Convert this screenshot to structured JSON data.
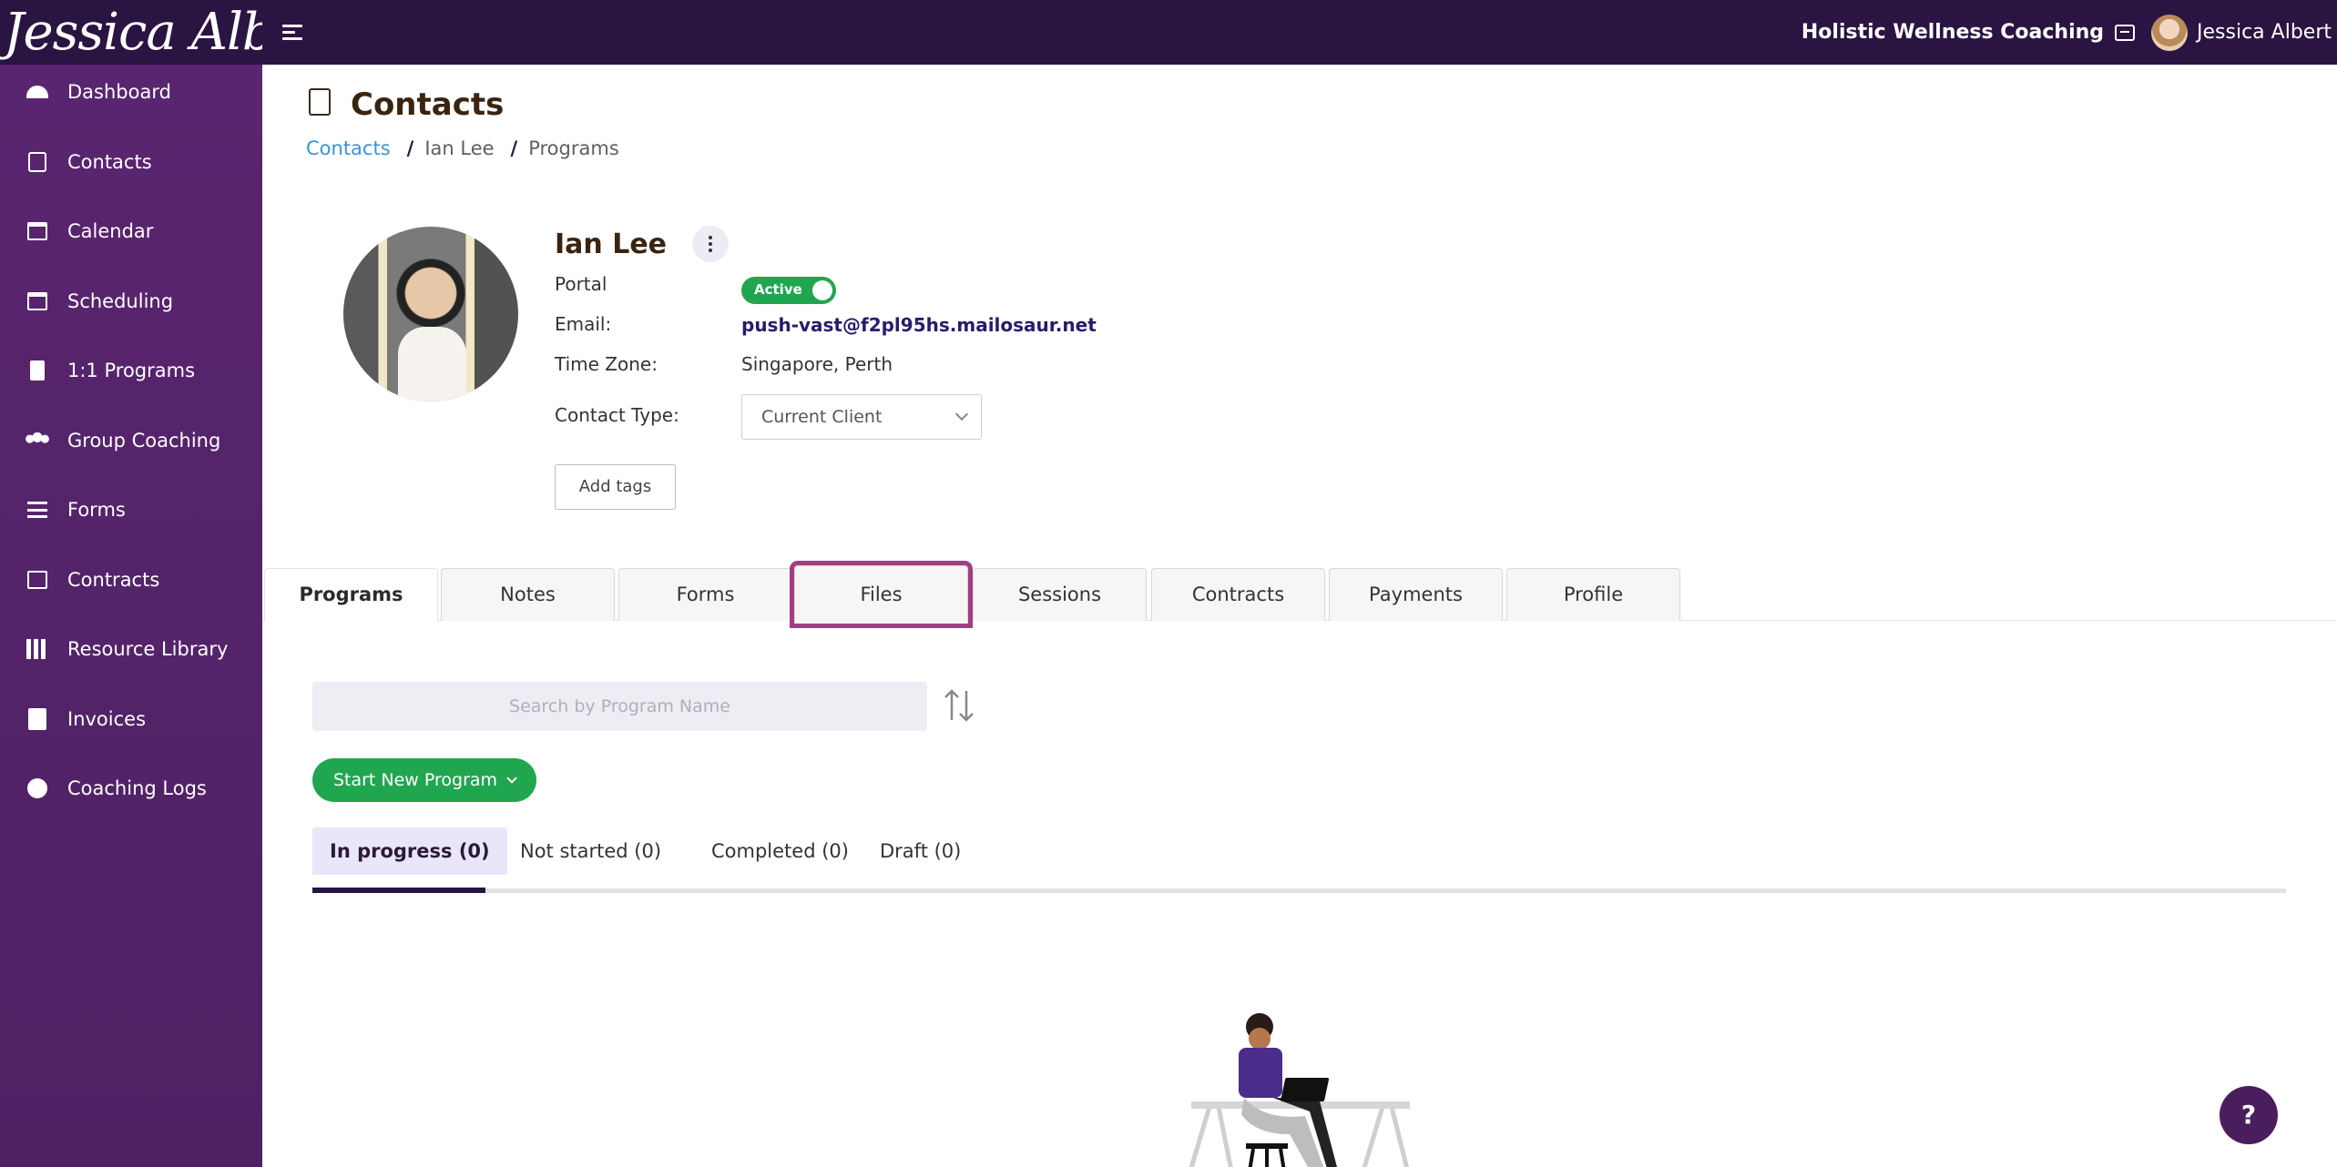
{
  "app": {
    "logo_text": "Jessica Albert",
    "business_name": "Holistic Wellness Coaching",
    "user_name": "Jessica Albert"
  },
  "sidebar": {
    "items": [
      {
        "label": "Dashboard",
        "icon": "dashboard-icon"
      },
      {
        "label": "Contacts",
        "icon": "contacts-icon"
      },
      {
        "label": "Calendar",
        "icon": "calendar-icon"
      },
      {
        "label": "Scheduling",
        "icon": "scheduling-icon"
      },
      {
        "label": "1:1 Programs",
        "icon": "book-icon"
      },
      {
        "label": "Group Coaching",
        "icon": "group-icon"
      },
      {
        "label": "Forms",
        "icon": "list-icon"
      },
      {
        "label": "Contracts",
        "icon": "signature-icon"
      },
      {
        "label": "Resource Library",
        "icon": "library-icon"
      },
      {
        "label": "Invoices",
        "icon": "invoice-icon"
      },
      {
        "label": "Coaching Logs",
        "icon": "clock-icon"
      }
    ]
  },
  "page": {
    "title": "Contacts",
    "breadcrumb": [
      "Contacts",
      "Ian Lee",
      "Programs"
    ]
  },
  "contact": {
    "name": "Ian Lee",
    "portal_label": "Portal",
    "portal_status": "Active",
    "email_label": "Email:",
    "email": "push-vast@f2pl95hs.mailosaur.net",
    "timezone_label": "Time Zone:",
    "timezone": "Singapore, Perth",
    "type_label": "Contact Type:",
    "type_value": "Current Client",
    "add_tags": "Add tags"
  },
  "tabs": [
    "Programs",
    "Notes",
    "Forms",
    "Files",
    "Sessions",
    "Contracts",
    "Payments",
    "Profile"
  ],
  "active_tab": "Programs",
  "highlighted_tab": "Files",
  "programs": {
    "search_placeholder": "Search by Program Name",
    "start_button": "Start New Program",
    "subtabs": [
      "In progress (0)",
      "Not started (0)",
      "Completed (0)",
      "Draft (0)"
    ]
  },
  "help_label": "?",
  "colors": {
    "topbar": "#2a1442",
    "sidebar": "#5a2570",
    "accent_green": "#21a650",
    "link_blue": "#3c93d8",
    "highlight_outline": "#a43d84"
  }
}
